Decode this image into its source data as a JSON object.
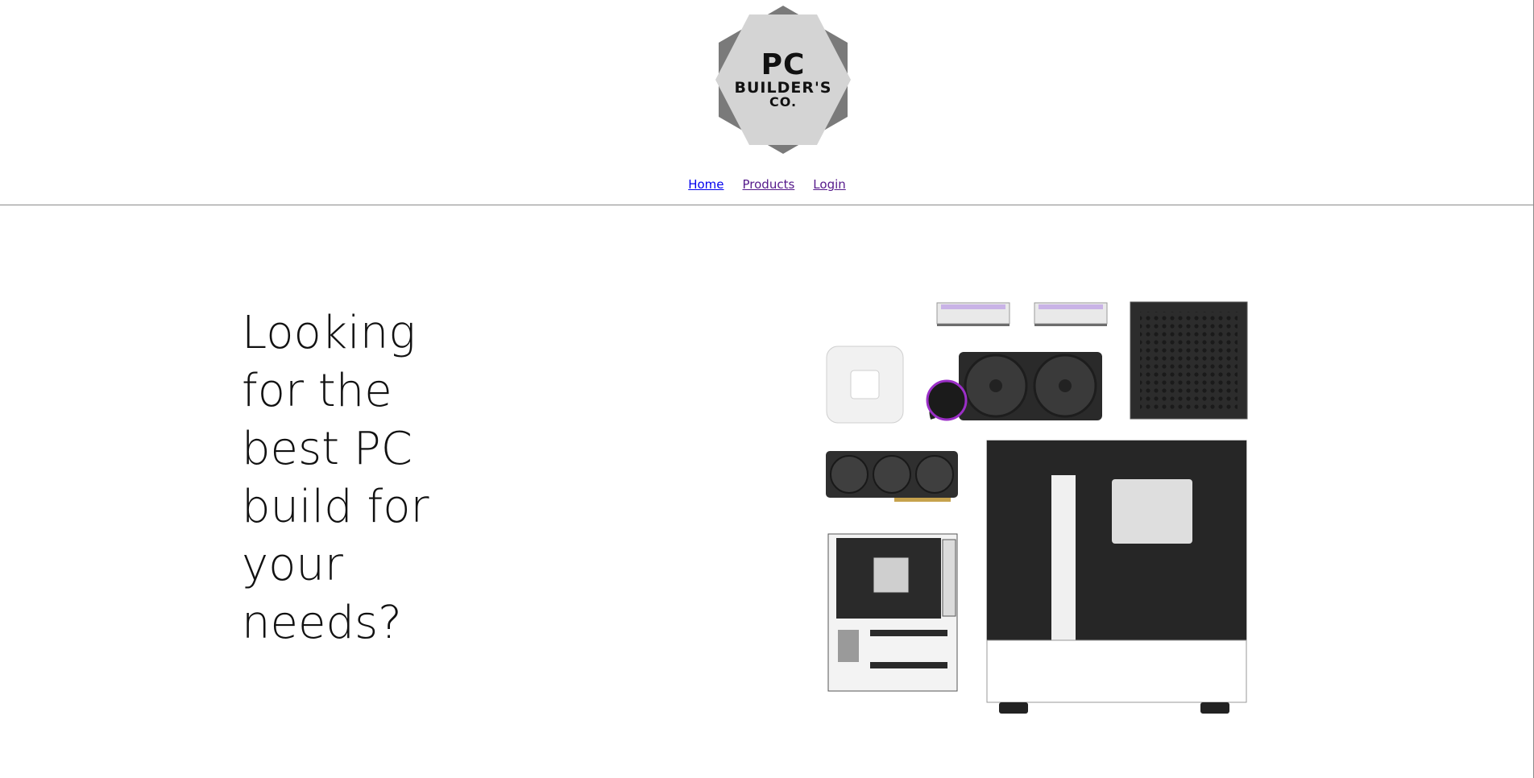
{
  "logo": {
    "line1": "PC",
    "line2": "BUILDER'S",
    "line3": "CO."
  },
  "nav": {
    "home": "Home",
    "products": "Products",
    "login": "Login"
  },
  "hero": {
    "title": "Looking\nfor the\nbest PC\nbuild for\nyour\nneeds?"
  },
  "colors": {
    "link_unvisited": "#0000ee",
    "link_visited": "#551a8b",
    "logo_outer": "#7a7a7a",
    "logo_inner": "#d4d4d4"
  }
}
